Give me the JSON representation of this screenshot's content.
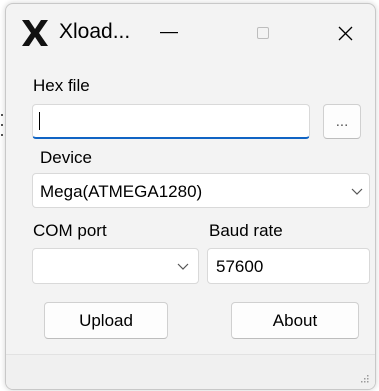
{
  "window": {
    "title": "Xload...",
    "icon": "x-logo-icon"
  },
  "form": {
    "hex_file_label": "Hex file",
    "hex_file_value": "",
    "browse_label": "...",
    "device_label": "Device",
    "device_selected": "Mega(ATMEGA1280)",
    "com_port_label": "COM port",
    "com_port_selected": "",
    "baud_rate_label": "Baud rate",
    "baud_rate_value": "57600"
  },
  "buttons": {
    "upload_label": "Upload",
    "about_label": "About"
  },
  "colors": {
    "focus_accent": "#1064c4",
    "window_bg": "#f3f3f3"
  }
}
